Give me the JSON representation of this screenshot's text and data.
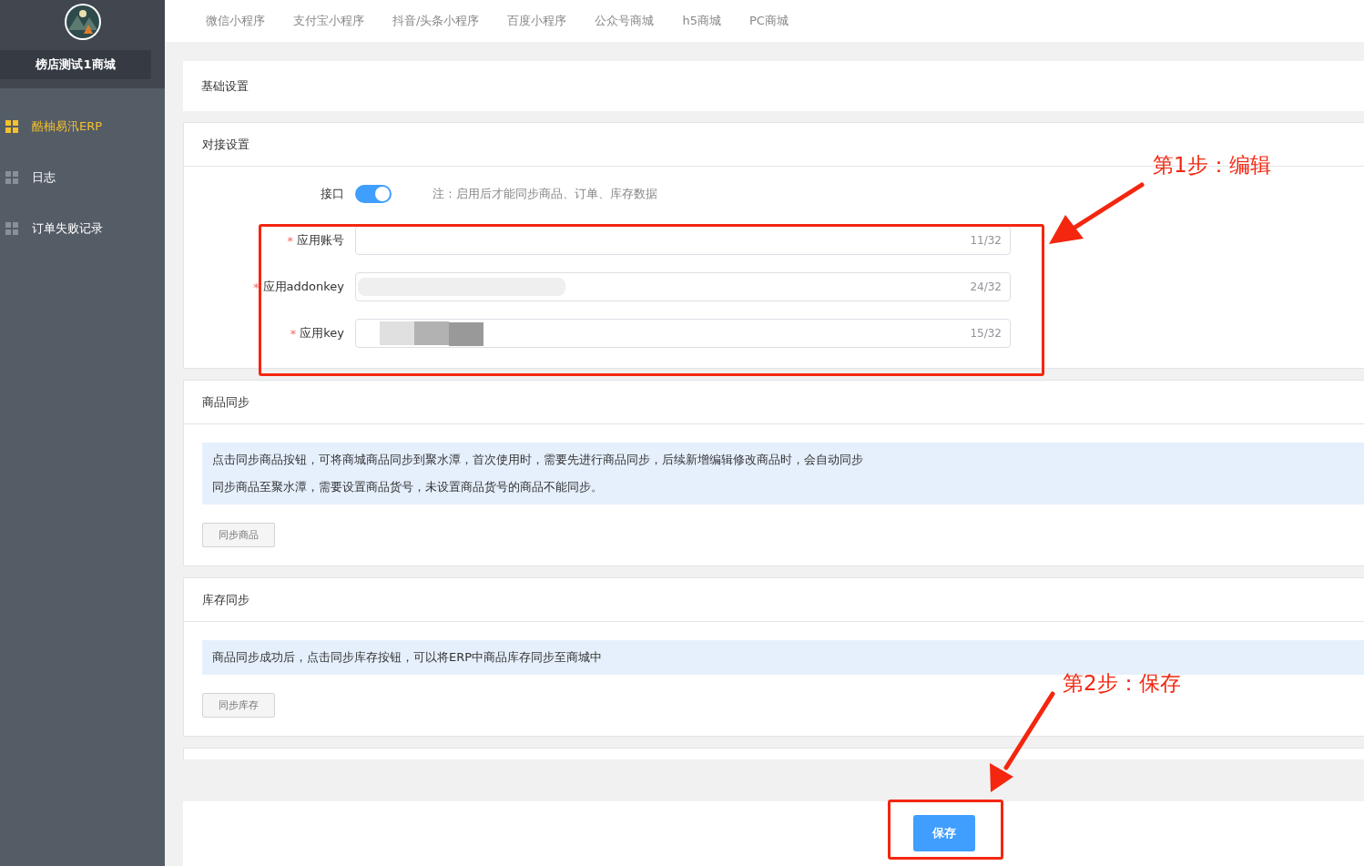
{
  "sidebar": {
    "shop_name": "榜店测试1商城",
    "items": [
      {
        "label": "酷柚易汛ERP",
        "selected": true
      },
      {
        "label": "日志",
        "selected": false
      },
      {
        "label": "订单失败记录",
        "selected": false
      }
    ]
  },
  "tabs": [
    {
      "label": "微信小程序"
    },
    {
      "label": "支付宝小程序"
    },
    {
      "label": "抖音/头条小程序"
    },
    {
      "label": "百度小程序"
    },
    {
      "label": "公众号商城"
    },
    {
      "label": "h5商城"
    },
    {
      "label": "PC商城"
    }
  ],
  "sections": [
    {
      "kind": "header",
      "title": "基础设置"
    },
    {
      "kind": "form",
      "title": "对接设置",
      "switch": {
        "label": "接口",
        "on": true,
        "note": "注：启用后才能同步商品、订单、库存数据"
      },
      "fields": [
        {
          "label": "应用账号",
          "required_mark": "*",
          "counter": "11/32"
        },
        {
          "label": "应用addonkey",
          "required_mark": "*",
          "counter": "24/32",
          "redacted": true
        },
        {
          "label": "应用key",
          "required_mark": "*",
          "counter": "15/32",
          "redacted": true
        }
      ]
    },
    {
      "kind": "sync",
      "title": "商品同步",
      "notes": [
        "点击同步商品按钮，可将商城商品同步到聚水潭，首次使用时，需要先进行商品同步，后续新增编辑修改商品时，会自动同步",
        "同步商品至聚水潭，需要设置商品货号，未设置商品货号的商品不能同步。"
      ],
      "button": "同步商品"
    },
    {
      "kind": "sync",
      "title": "库存同步",
      "notes": [
        "商品同步成功后，点击同步库存按钮，可以将ERP中商品库存同步至商城中"
      ],
      "button": "同步库存"
    },
    {
      "kind": "empty"
    }
  ],
  "footer": {
    "button": "保存"
  },
  "annotations": [
    {
      "text": "第1步：编辑"
    },
    {
      "text": "第2步：保存"
    }
  ]
}
